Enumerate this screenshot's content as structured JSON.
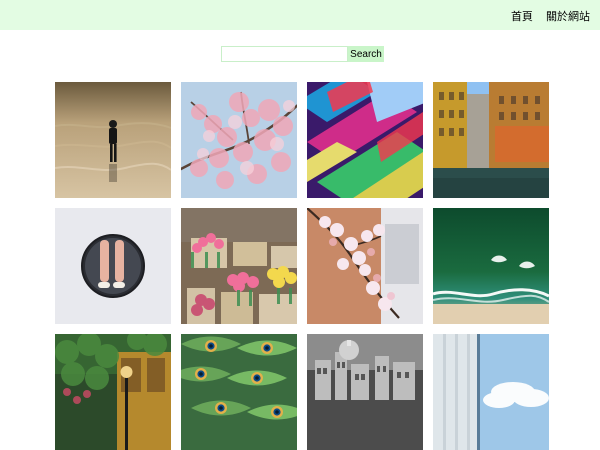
{
  "nav": {
    "items": [
      "首頁",
      "關於網站"
    ]
  },
  "search": {
    "button_label": "Search",
    "placeholder": "",
    "value": ""
  },
  "gallery": {
    "tiles": [
      {
        "name": "beach-person-photo"
      },
      {
        "name": "cherry-blossom-photo"
      },
      {
        "name": "color-blur-photo"
      },
      {
        "name": "river-buildings-photo"
      },
      {
        "name": "mirror-legs-photo"
      },
      {
        "name": "tulip-market-photo"
      },
      {
        "name": "blossom-branch-photo"
      },
      {
        "name": "ocean-shore-photo"
      },
      {
        "name": "lamp-garden-photo"
      },
      {
        "name": "peacock-feathers-photo"
      },
      {
        "name": "rooftops-bw-photo"
      },
      {
        "name": "sky-window-photo"
      }
    ]
  }
}
